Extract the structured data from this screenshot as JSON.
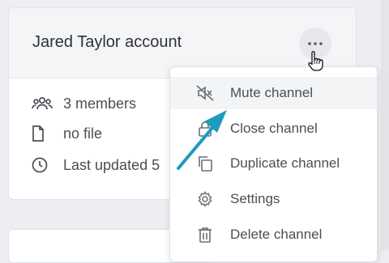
{
  "card": {
    "title": "Jared Taylor account",
    "members": "3 members",
    "file": "no file",
    "updated": "Last updated 5"
  },
  "menu": {
    "items": [
      {
        "label": "Mute channel",
        "icon": "mute-icon"
      },
      {
        "label": "Close channel",
        "icon": "lock-icon"
      },
      {
        "label": "Duplicate channel",
        "icon": "duplicate-icon"
      },
      {
        "label": "Settings",
        "icon": "gear-icon"
      },
      {
        "label": "Delete channel",
        "icon": "trash-icon"
      }
    ]
  },
  "colors": {
    "arrow": "#1f9bbf",
    "text": "#4a4f55"
  }
}
